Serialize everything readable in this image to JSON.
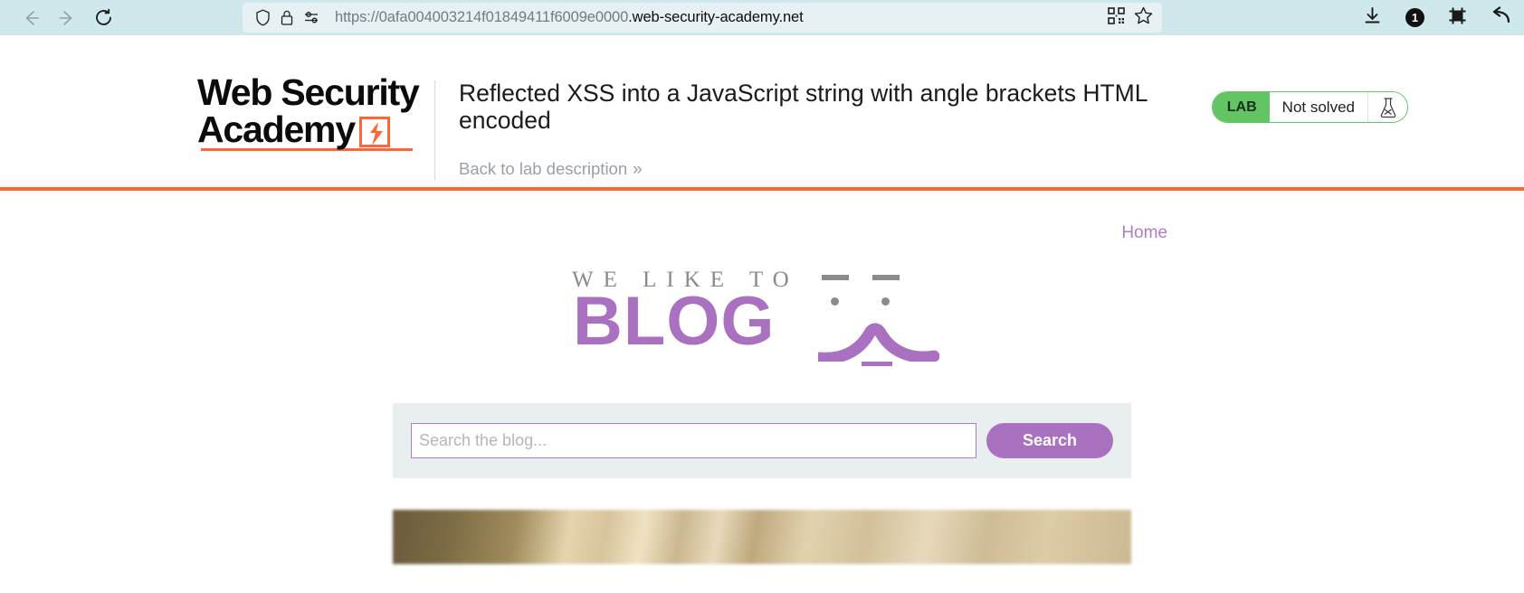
{
  "browser": {
    "back_icon": "back-arrow-icon",
    "forward_icon": "forward-arrow-icon",
    "reload_icon": "reload-icon",
    "shield_icon": "shield-icon",
    "lock_icon": "lock-icon",
    "permissions_icon": "permissions-icon",
    "url_scheme": "https://",
    "url_subdomain": "0afa004003214f01849411f6009e0000",
    "url_domain": ".web-security-academy.net",
    "url_full": "https://0afa004003214f01849411f6009e0000.web-security-academy.net",
    "qr_icon": "qr-code-icon",
    "bookmark_icon": "star-bookmark-icon",
    "download_icon": "download-icon",
    "notification_count": "1",
    "screenshot_icon": "crop-screenshot-icon",
    "undo_icon": "undo-arrow-icon"
  },
  "lab": {
    "logo_line1": "Web Security",
    "logo_line2": "Academy",
    "logo_bolt_icon": "lightning-bolt-icon",
    "title": "Reflected XSS into a JavaScript string with angle brackets HTML encoded",
    "back_link": "Back to lab description",
    "back_link_chevron": "»",
    "status_tag": "LAB",
    "status_text": "Not solved",
    "status_icon": "flask-icon",
    "accent_orange": "#ff6633",
    "accent_green": "#62c462"
  },
  "blog": {
    "nav": {
      "home": "Home"
    },
    "heading_small": "WE LIKE TO",
    "heading_large": "BLOG",
    "face_icon": "kaomoji-face-icon",
    "accent_purple": "#a971bf",
    "search": {
      "placeholder": "Search the blog...",
      "value": "",
      "button_label": "Search"
    },
    "hero_image": "blurred-interior-photo"
  }
}
